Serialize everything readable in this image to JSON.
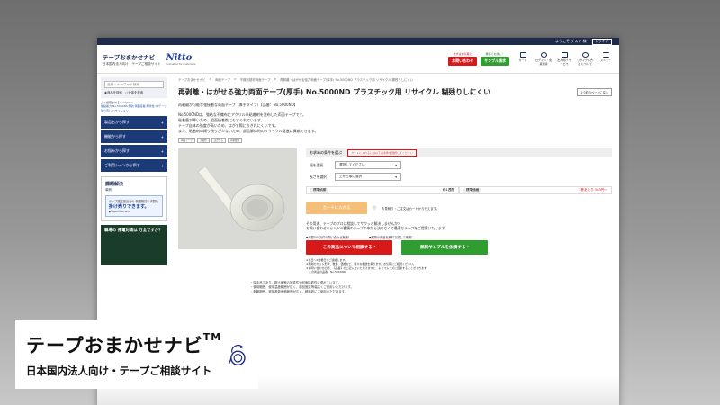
{
  "topbar": {
    "welcome": "ようこそ ゲスト 様",
    "login": "ログイン"
  },
  "header": {
    "site_title": "テープおまかせナビ",
    "site_sub": "日本国内法人向け・テープご相談サイト",
    "brand": "Nitto",
    "brand_sub": "Innovation for Customers",
    "cta_consult_note": "まずはお気軽に",
    "cta_consult": "お問い合わせ",
    "cta_sample_note": "無料でお試し！",
    "cta_sample": "サンプル請求",
    "icons": [
      {
        "name": "cart-icon",
        "label": "カート"
      },
      {
        "name": "login-icon",
        "label": "ログイン・会員登録"
      },
      {
        "name": "company-icon",
        "label": "法人向け サービス"
      },
      {
        "name": "recycle-icon",
        "label": "リサイクル方法 について"
      },
      {
        "name": "menu-icon",
        "label": "メニュー"
      }
    ]
  },
  "sidebar": {
    "search_placeholder": "品番・キーワード検索",
    "radio_label": "◉商品を検索　○全体を検索",
    "links_label": "よく検索されるキーワード",
    "links": "強粘着力 No.5000NS 耐熱 両面接着 耐寒性 CPテープ 貼り直し ○クッション",
    "nav": [
      "製品名から探す",
      "機能から探す",
      "お悩みから探す",
      "ご利用シーンから探す"
    ],
    "banner1_title": "課題解決",
    "banner1_sub": "事例",
    "banner2_line": "テープ選定担当者の 剥離検討の手間を",
    "banner2_big": "掛け売りできます。",
    "banner2_foot": "▶Tape-Hansen",
    "banner3": "職場の 停電対策は 万全ですか？"
  },
  "breadcrumb": [
    "テープおまかせナビ",
    ">",
    "両面テープ",
    ">",
    "不織布基材両面テープ",
    ">",
    "再剥離・はがせる強力両面テープ(厚手) No.5000ND プラスチック用 リサイクル 糊残りしにくい"
  ],
  "product": {
    "title": "再剥離・はがせる強力両面テープ(厚手) No.5000ND プラスチック用 リサイクル 糊残りしにくい",
    "back": "1つ前のページに戻る",
    "spec": "再剥離が可能な強接着な両面テープ（厚手タイプ）【品番：No.5000ND】",
    "desc": [
      "No.5000NDは、強粘な不織布にアクリル系粘着剤を塗布した両面テープです。",
      "粘着層が厚いため、粗面接着性にもすぐれています。",
      "テープ自体の強度が高いため、はがす際にちぎれにくいです。",
      "また、粘着剤の糊り残りが少ないため、部品解体時のリサイクル促進に貢献できます。"
    ],
    "tags": [
      "両面テープ",
      "不織布",
      "はがせる",
      "再剥離性"
    ]
  },
  "panel": {
    "head": "お求めの条件を選ぶ",
    "head_note": "カートに入れるには以下の条件を選択してください",
    "width_label": "幅を選択",
    "width_value": "選択してください",
    "length_label": "長さを選択",
    "length_value": "上から順に選択",
    "lead_k": "標準納期",
    "lead_v": "約1週間",
    "price_k": "標準価格",
    "price_v": "1巻あたり 563円〜",
    "cart": "カートに入れる",
    "cart_note": "お見積り・ご注文はカートから行えます。",
    "consult_lines": [
      "その用途、テープのプロに相談してサクッと解決しませんか?",
      "お問い合わせなら3,800種類のテープの中から決めなくて最適なテープをご提案いたします。"
    ],
    "label_left": "▼月間500万件の問い合わせ実績！",
    "label_right": "▼実際の商品を無料で試して納得！",
    "btn_consult": "この商品について相談する",
    "btn_sample": "無料サンプルを依頼する",
    "notes": [
      "※当日〜2営業日でご連絡します。",
      "※現場のカット形状、数量、価格など、様々な相談を承ります。お気軽にご相談ください。",
      "※お問い合わせの際、【品番】のご記入をいただけますと、よりスムーズに回答することができます。",
      "　この商品の品番：No.5000ND"
    ]
  },
  "bottom_spec": [
    "・厚手品であり、粗比面等の加重性や耐面接着性に優れています。",
    "・使用範囲、使用温度範囲が広く、部品固定等幅広くご使用いただけます。",
    "・剥離範囲、被接着剤面積範囲が広く、軽粘着にご使用いただけます。"
  ],
  "overlay": {
    "title": "テープおまかせナビ",
    "tm": "TM",
    "subtitle": "日本国内法人向け・テープご相談サイト"
  }
}
